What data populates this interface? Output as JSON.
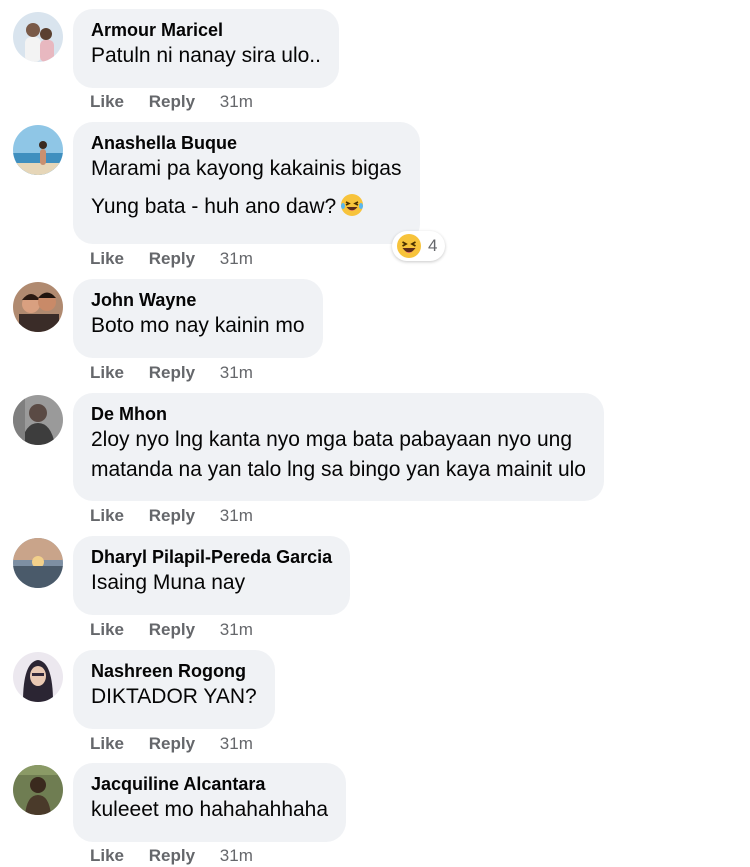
{
  "comments": [
    {
      "author": "Armour Maricel",
      "lines": [
        "Patuln ni nanay sira ulo.."
      ],
      "like": "Like",
      "reply": "Reply",
      "time": "31m"
    },
    {
      "author": "Anashella Buque",
      "lines": [
        "Marami pa kayong kakainis bigas",
        "Yung bata - huh ano daw?"
      ],
      "emoji_inline": "laughing-tears-emoji",
      "like": "Like",
      "reply": "Reply",
      "time": "31m",
      "reaction": {
        "icon": "haha-reaction-icon",
        "count": "4"
      }
    },
    {
      "author": "John Wayne",
      "lines": [
        "Boto mo nay kainin mo"
      ],
      "like": "Like",
      "reply": "Reply",
      "time": "31m"
    },
    {
      "author": "De Mhon",
      "lines": [
        "2loy nyo lng kanta nyo mga bata pabayaan nyo ung",
        "matanda na yan talo lng sa bingo yan kaya mainit ulo"
      ],
      "like": "Like",
      "reply": "Reply",
      "time": "31m"
    },
    {
      "author": "Dharyl Pilapil-Pereda Garcia",
      "lines": [
        "Isaing Muna nay"
      ],
      "like": "Like",
      "reply": "Reply",
      "time": "31m"
    },
    {
      "author": "Nashreen Rogong",
      "lines": [
        "DIKTADOR YAN?"
      ],
      "like": "Like",
      "reply": "Reply",
      "time": "31m"
    },
    {
      "author": "Jacquiline Alcantara",
      "lines": [
        "kuleeet mo hahahahhaha"
      ],
      "like": "Like",
      "reply": "Reply",
      "time": "31m"
    }
  ],
  "colors": {
    "bubble": "#f0f2f5",
    "meta": "#65676b",
    "text": "#050505"
  }
}
